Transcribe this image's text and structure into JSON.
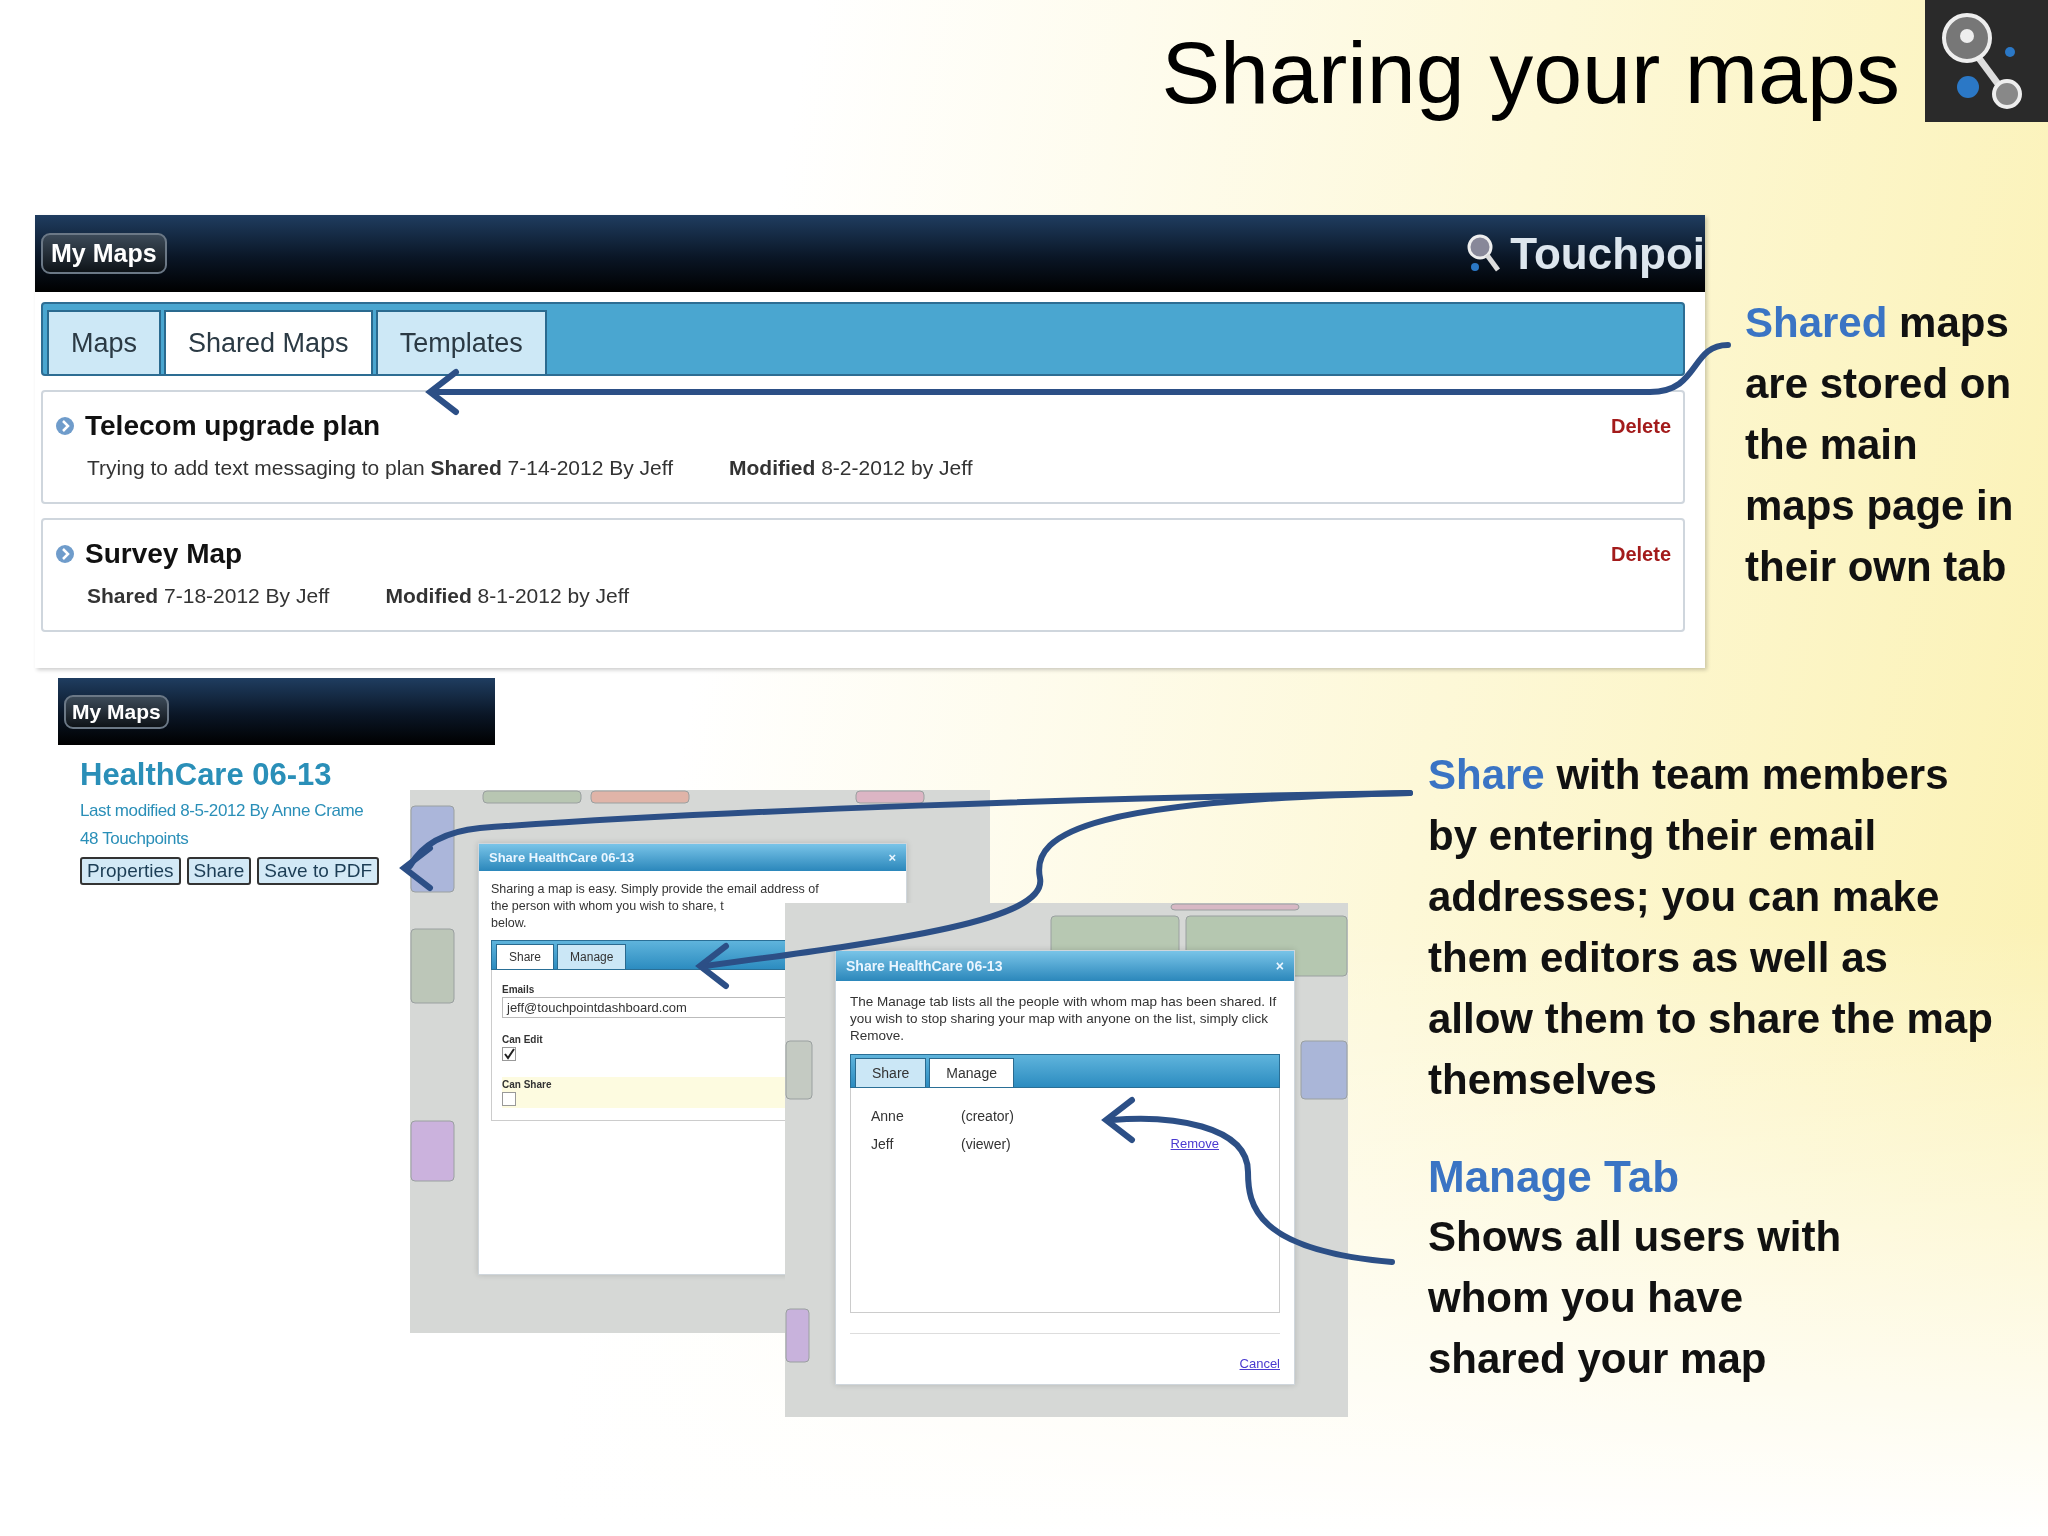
{
  "title": "Sharing your maps",
  "shared_maps_screen": {
    "header_button": "My Maps",
    "brand": "Touchpoi",
    "tabs": [
      {
        "label": "Maps",
        "selected": false
      },
      {
        "label": "Shared Maps",
        "selected": true
      },
      {
        "label": "Templates",
        "selected": false
      }
    ],
    "maps": [
      {
        "title": "Telecom upgrade plan",
        "details": [
          "Trying to add text messaging to plan **Shared** 7-14-2012 By Jeff",
          "**Modified** 8-2-2012 by Jeff"
        ],
        "action": "Delete"
      },
      {
        "title": "Survey Map",
        "details": [
          "**Shared** 7-18-2012 By Jeff",
          "**Modified** 8-1-2012 by Jeff"
        ],
        "action": "Delete"
      }
    ]
  },
  "callout_shared": {
    "highlight": "Shared",
    "text": "maps are stored on the main maps page in their own tab"
  },
  "map_screen": {
    "header_button": "My Maps",
    "map_title": "HealthCare 06-13",
    "last_modified": "Last modified 8-5-2012 By Anne Crame",
    "count": "48 Touchpoints",
    "buttons": [
      "Properties",
      "Share",
      "Save to PDF"
    ]
  },
  "share_dialog": {
    "title": "Share HealthCare 06-13",
    "close": "×",
    "intro": [
      "Sharing a map is easy. Simply provide the email address of",
      "the person with whom you wish to share, t",
      "below."
    ],
    "tabs": [
      {
        "label": "Share",
        "selected": true
      },
      {
        "label": "Manage",
        "selected": false
      }
    ],
    "emails_label": "Emails",
    "emails_value": "jeff@touchpointdashboard.com",
    "options": [
      {
        "label": "Can Edit",
        "checked": true
      },
      {
        "label": "Can Share",
        "checked": false
      }
    ]
  },
  "manage_dialog": {
    "title": "Share HealthCare 06-13",
    "close": "×",
    "intro": "The Manage tab lists all the people with whom map has been shared. If you wish to stop sharing your map with anyone on the list, simply click Remove.",
    "tabs": [
      {
        "label": "Share",
        "selected": false
      },
      {
        "label": "Manage",
        "selected": true
      }
    ],
    "people": [
      {
        "name": "Anne",
        "role": "(creator)"
      },
      {
        "name": "Jeff",
        "role": "(viewer)",
        "action": "Remove"
      }
    ],
    "cancel": "Cancel"
  },
  "callout_share": {
    "highlight": "Share",
    "text": "with team members by entering their email addresses; you can make them editors as well as allow them to share the map themselves"
  },
  "callout_manage": {
    "heading": "Manage Tab",
    "text": "Shows all users with whom you have shared your map"
  }
}
